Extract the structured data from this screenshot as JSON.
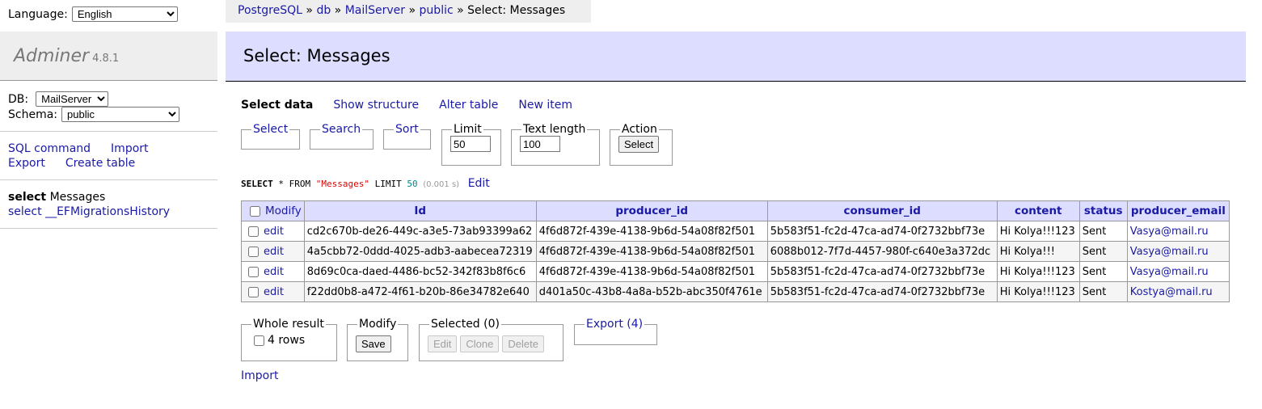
{
  "language": {
    "label": "Language:",
    "selected": "English"
  },
  "brand": {
    "name": "Adminer",
    "version": "4.8.1"
  },
  "db": {
    "db_label": "DB:",
    "db_selected": "MailServer",
    "schema_label": "Schema:",
    "schema_selected": "public"
  },
  "menu_links": {
    "sql_command": "SQL command",
    "import": "Import",
    "export": "Export",
    "create_table": "Create table"
  },
  "tables": [
    {
      "action": "select",
      "name": "Messages",
      "current": true
    },
    {
      "action": "select",
      "name": "__EFMigrationsHistory",
      "current": false
    }
  ],
  "breadcrumb": {
    "pg": "PostgreSQL",
    "db": "db",
    "server": "MailServer",
    "schema": "public",
    "current": "Select: Messages",
    "sep": "»"
  },
  "page_title": "Select: Messages",
  "tabs": {
    "select_data": "Select data",
    "show_structure": "Show structure",
    "alter_table": "Alter table",
    "new_item": "New item"
  },
  "controls": {
    "select": "Select",
    "search": "Search",
    "sort": "Sort",
    "limit_label": "Limit",
    "limit_value": "50",
    "text_length_label": "Text length",
    "text_length_value": "100",
    "action_label": "Action",
    "action_button": "Select"
  },
  "sql": {
    "kw1": "SELECT",
    "star": "*",
    "kw2": "FROM",
    "table": "\"Messages\"",
    "kw3": "LIMIT",
    "limit": "50",
    "time": "(0.001 s)",
    "edit": "Edit"
  },
  "grid": {
    "modify_header": "Modify",
    "columns": [
      "Id",
      "producer_id",
      "consumer_id",
      "content",
      "status",
      "producer_email"
    ],
    "edit_label": "edit",
    "rows": [
      [
        "cd2c670b-de26-449c-a3e5-73ab93399a62",
        "4f6d872f-439e-4138-9b6d-54a08f82f501",
        "5b583f51-fc2d-47ca-ad74-0f2732bbf73e",
        "Hi Kolya!!!123",
        "Sent",
        "Vasya@mail.ru"
      ],
      [
        "4a5cbb72-0ddd-4025-adb3-aabecea72319",
        "4f6d872f-439e-4138-9b6d-54a08f82f501",
        "6088b012-7f7d-4457-980f-c640e3a372dc",
        "Hi Kolya!!!",
        "Sent",
        "Vasya@mail.ru"
      ],
      [
        "8d69c0ca-daed-4486-bc52-342f83b8f6c6",
        "4f6d872f-439e-4138-9b6d-54a08f82f501",
        "5b583f51-fc2d-47ca-ad74-0f2732bbf73e",
        "Hi Kolya!!!123",
        "Sent",
        "Vasya@mail.ru"
      ],
      [
        "f22dd0b8-a472-4f61-b20b-86e34782e640",
        "d401a50c-43b8-4a8a-b52b-abc350f4761e",
        "5b583f51-fc2d-47ca-ad74-0f2732bbf73e",
        "Hi Kolya!!!123",
        "Sent",
        "Kostya@mail.ru"
      ]
    ]
  },
  "bottom": {
    "whole_result": "Whole result",
    "rows_label": "4 rows",
    "modify": "Modify",
    "save": "Save",
    "selected": "Selected (0)",
    "edit": "Edit",
    "clone": "Clone",
    "delete": "Delete",
    "export": "Export (4)",
    "import": "Import"
  },
  "colors": {
    "header_bg": "#ddf",
    "link": "#1a1aa6",
    "brand_bg": "#eee"
  }
}
